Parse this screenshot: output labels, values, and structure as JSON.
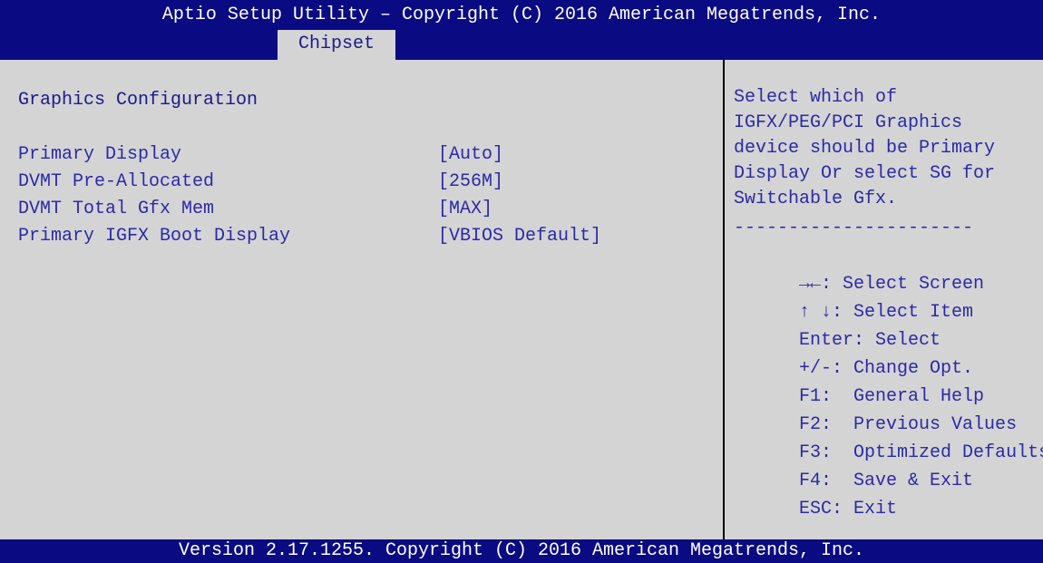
{
  "header": {
    "title": "Aptio Setup Utility – Copyright (C) 2016 American Megatrends, Inc.",
    "active_tab": "Chipset"
  },
  "main": {
    "section_title": "Graphics Configuration",
    "settings": [
      {
        "label": "Primary Display",
        "value": "[Auto]"
      },
      {
        "label": "DVMT Pre-Allocated",
        "value": "[256M]"
      },
      {
        "label": "DVMT Total Gfx Mem",
        "value": "[MAX]"
      },
      {
        "label": "Primary IGFX Boot Display",
        "value": "[VBIOS Default]"
      }
    ]
  },
  "help": {
    "description_lines": [
      "Select which of",
      "IGFX/PEG/PCI Graphics",
      "device should be Primary",
      "Display Or select SG for",
      "Switchable Gfx."
    ],
    "separator": "----------------------",
    "keys": [
      {
        "key": "→←:",
        "desc": " Select Screen"
      },
      {
        "key": "↑ ↓:",
        "desc": " Select Item"
      },
      {
        "key": "Enter:",
        "desc": " Select"
      },
      {
        "key": "+/-:",
        "desc": " Change Opt."
      },
      {
        "key": "F1:",
        "desc": "  General Help"
      },
      {
        "key": "F2:",
        "desc": "  Previous Values"
      },
      {
        "key": "F3:",
        "desc": "  Optimized Defaults"
      },
      {
        "key": "F4:",
        "desc": "  Save & Exit"
      },
      {
        "key": "ESC:",
        "desc": " Exit"
      }
    ]
  },
  "footer": {
    "version_text": "Version 2.17.1255. Copyright (C) 2016 American Megatrends, Inc."
  },
  "colors": {
    "bar_background": "#0a0a82",
    "panel_background": "#d4d4d4",
    "text": "#2a2aa8",
    "bar_text": "#ffffff"
  }
}
